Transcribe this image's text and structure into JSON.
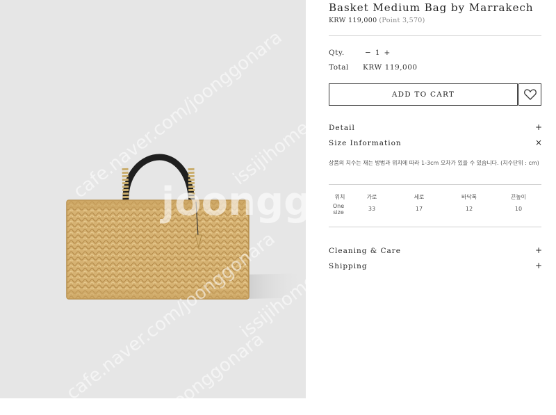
{
  "product": {
    "title": "Basket Medium Bag by Marrakech",
    "price": "KRW 119,000",
    "points": "(Point 3,570)"
  },
  "purchase": {
    "qty_label": "Qty.",
    "qty_minus": "−",
    "qty_value": "1",
    "qty_plus": "+",
    "total_label": "Total",
    "total_value": "KRW 119,000",
    "add_to_cart": "ADD TO CART",
    "wishlist_icon": "heart-icon"
  },
  "accordion": {
    "detail": {
      "label": "Detail",
      "symbol": "+"
    },
    "size_info": {
      "label": "Size Information",
      "symbol": "×",
      "note": "상품의 치수는 재는 방법과 위치에 따라 1-3cm 오차가 있을 수 있습니다. (치수단위 : cm)",
      "headers": [
        "위치",
        "가로",
        "세로",
        "바닥폭",
        "끈높이"
      ],
      "row": [
        "One size",
        "33",
        "17",
        "12",
        "10"
      ]
    },
    "care": {
      "label": "Cleaning & Care",
      "symbol": "+"
    },
    "shipping": {
      "label": "Shipping",
      "symbol": "+"
    }
  },
  "watermarks": [
    "cafe.naver.com/joonggonara",
    "issijihome.net",
    "joonggonara",
    "cafe.naver.com/joonggonara",
    "issijihome.net",
    "joonggonara"
  ],
  "colors": {
    "photo_bg": "#e6e6e6",
    "straw": "#d9b676",
    "handle": "#1f1f1f",
    "border": "#333333"
  }
}
